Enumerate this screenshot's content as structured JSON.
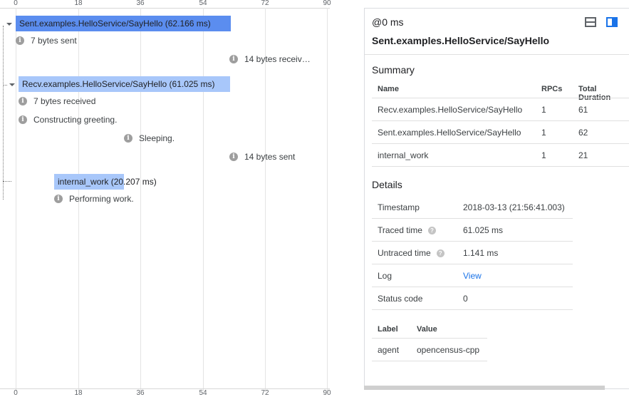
{
  "timeline": {
    "ticks": [
      "0",
      "18",
      "36",
      "54",
      "72",
      "90"
    ],
    "spans": [
      {
        "label": "Sent.examples.HelloService/SayHello (62.166 ms)",
        "color": "#5b8def"
      },
      {
        "label": "Recv.examples.HelloService/SayHello (61.025 ms)",
        "color": "#a8c7fa"
      },
      {
        "label": "internal_work (20.207 ms)",
        "color": "#a8c7fa"
      }
    ],
    "annotations": [
      {
        "text": "7 bytes sent"
      },
      {
        "text": "14 bytes receiv…"
      },
      {
        "text": "7 bytes received"
      },
      {
        "text": "Constructing greeting."
      },
      {
        "text": "Sleeping."
      },
      {
        "text": "14 bytes sent"
      },
      {
        "text": "Performing work."
      }
    ]
  },
  "details": {
    "time": "@0 ms",
    "title": "Sent.examples.HelloService/SayHello",
    "summary": {
      "heading": "Summary",
      "columns": [
        "Name",
        "RPCs",
        "Total Duration"
      ],
      "rows": [
        [
          "Recv.examples.HelloService/SayHello",
          "1",
          "61"
        ],
        [
          "Sent.examples.HelloService/SayHello",
          "1",
          "62"
        ],
        [
          "internal_work",
          "1",
          "21"
        ]
      ]
    },
    "info": {
      "heading": "Details",
      "rows": [
        {
          "label": "Timestamp",
          "value": "2018-03-13 (21:56:41.003)"
        },
        {
          "label": "Traced time",
          "value": "61.025 ms"
        },
        {
          "label": "Untraced time",
          "value": "1.141 ms"
        },
        {
          "label": "Log",
          "value": "View"
        },
        {
          "label": "Status code",
          "value": "0"
        }
      ]
    },
    "labels": {
      "columns": [
        "Label",
        "Value"
      ],
      "rows": [
        [
          "agent",
          "opencensus-cpp"
        ]
      ]
    }
  }
}
